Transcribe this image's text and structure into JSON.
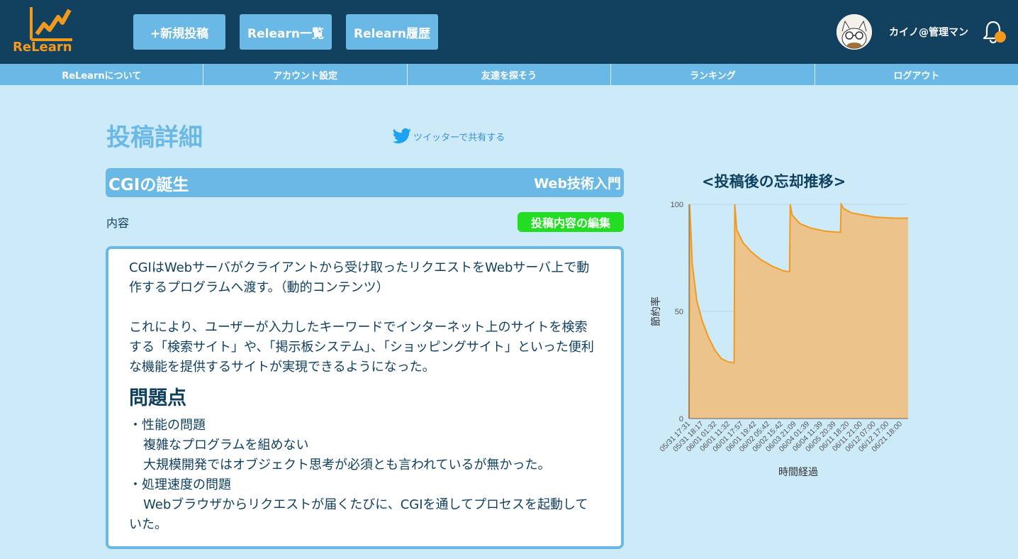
{
  "header": {
    "logo_text": "ReLearn",
    "buttons": [
      "+新規投稿",
      "Relearn一覧",
      "Relearn履歴"
    ],
    "username": "カイノ@管理マン",
    "accent_color": "#f39a1e",
    "bg_color": "#12405f"
  },
  "nav": {
    "items": [
      "ReLearnについて",
      "アカウント設定",
      "友達を探そう",
      "ランキング",
      "ログアウト"
    ]
  },
  "page": {
    "title": "投稿詳細",
    "share_label": "ツイッターで共有する"
  },
  "post": {
    "title": "CGIの誕生",
    "category": "Web技術入門",
    "content_label": "内容",
    "edit_button": "投稿内容の編集",
    "paragraphs": [
      "CGIはWebサーバがクライアントから受け取ったリクエストをWebサーバ上で動作するプログラムへ渡す。（動的コンテンツ）",
      "これにより、ユーザーが入力したキーワードでインターネット上のサイトを検索する「検索サイト」や、「掲示板システム」、「ショッピングサイト」といった便利な機能を提供するサイトが実現できるようになった。"
    ],
    "section_heading": "問題点",
    "list": [
      "・性能の問題",
      "複雑なプログラムを組めない",
      "大規模開発ではオブジェクト思考が必須とも言われているが無かった。",
      "・処理速度の問題",
      "Webブラウザからリクエストが届くたびに、CGIを通してプロセスを起動していた。"
    ]
  },
  "chart_title": "<投稿後の忘却推移>",
  "chart_data": {
    "type": "area",
    "ylabel": "節約率",
    "xlabel": "時間経過",
    "ylim": [
      0,
      100
    ],
    "yticks": [
      0,
      50,
      100
    ],
    "fill_color": "#edc38c",
    "line_color": "#f39a1e",
    "categories": [
      "05/31 17:31",
      "05/31 18:17",
      "06/01 01:32",
      "06/01 11:32",
      "06/01 17:57",
      "06/01 19:42",
      "06/02 05:42",
      "06/02 15:42",
      "06/03 21:09",
      "06/04 01:39",
      "06/04 11:39",
      "06/05 20:39",
      "06/11 18:20",
      "06/11 21:00",
      "06/12 07:00",
      "06/12 17:00",
      "06/21 18:00"
    ],
    "points": [
      {
        "x": 0.0,
        "y": 0
      },
      {
        "x": 0.05,
        "y": 100
      },
      {
        "x": 0.25,
        "y": 72
      },
      {
        "x": 0.6,
        "y": 55
      },
      {
        "x": 1.0,
        "y": 46
      },
      {
        "x": 1.5,
        "y": 38
      },
      {
        "x": 2.0,
        "y": 32
      },
      {
        "x": 2.5,
        "y": 28
      },
      {
        "x": 3.0,
        "y": 26.5
      },
      {
        "x": 3.5,
        "y": 26
      },
      {
        "x": 3.55,
        "y": 100
      },
      {
        "x": 3.7,
        "y": 88
      },
      {
        "x": 4.2,
        "y": 82
      },
      {
        "x": 4.8,
        "y": 78
      },
      {
        "x": 5.6,
        "y": 74
      },
      {
        "x": 6.5,
        "y": 71
      },
      {
        "x": 7.3,
        "y": 69
      },
      {
        "x": 7.8,
        "y": 68.5
      },
      {
        "x": 7.85,
        "y": 100
      },
      {
        "x": 8.0,
        "y": 95
      },
      {
        "x": 8.6,
        "y": 91
      },
      {
        "x": 9.4,
        "y": 89
      },
      {
        "x": 10.5,
        "y": 87.5
      },
      {
        "x": 11.5,
        "y": 87
      },
      {
        "x": 11.75,
        "y": 87
      },
      {
        "x": 11.8,
        "y": 100
      },
      {
        "x": 12.0,
        "y": 98
      },
      {
        "x": 12.6,
        "y": 96
      },
      {
        "x": 13.5,
        "y": 95
      },
      {
        "x": 14.5,
        "y": 94
      },
      {
        "x": 16.0,
        "y": 93.5
      },
      {
        "x": 17.0,
        "y": 93.5
      }
    ],
    "x_max": 17
  }
}
